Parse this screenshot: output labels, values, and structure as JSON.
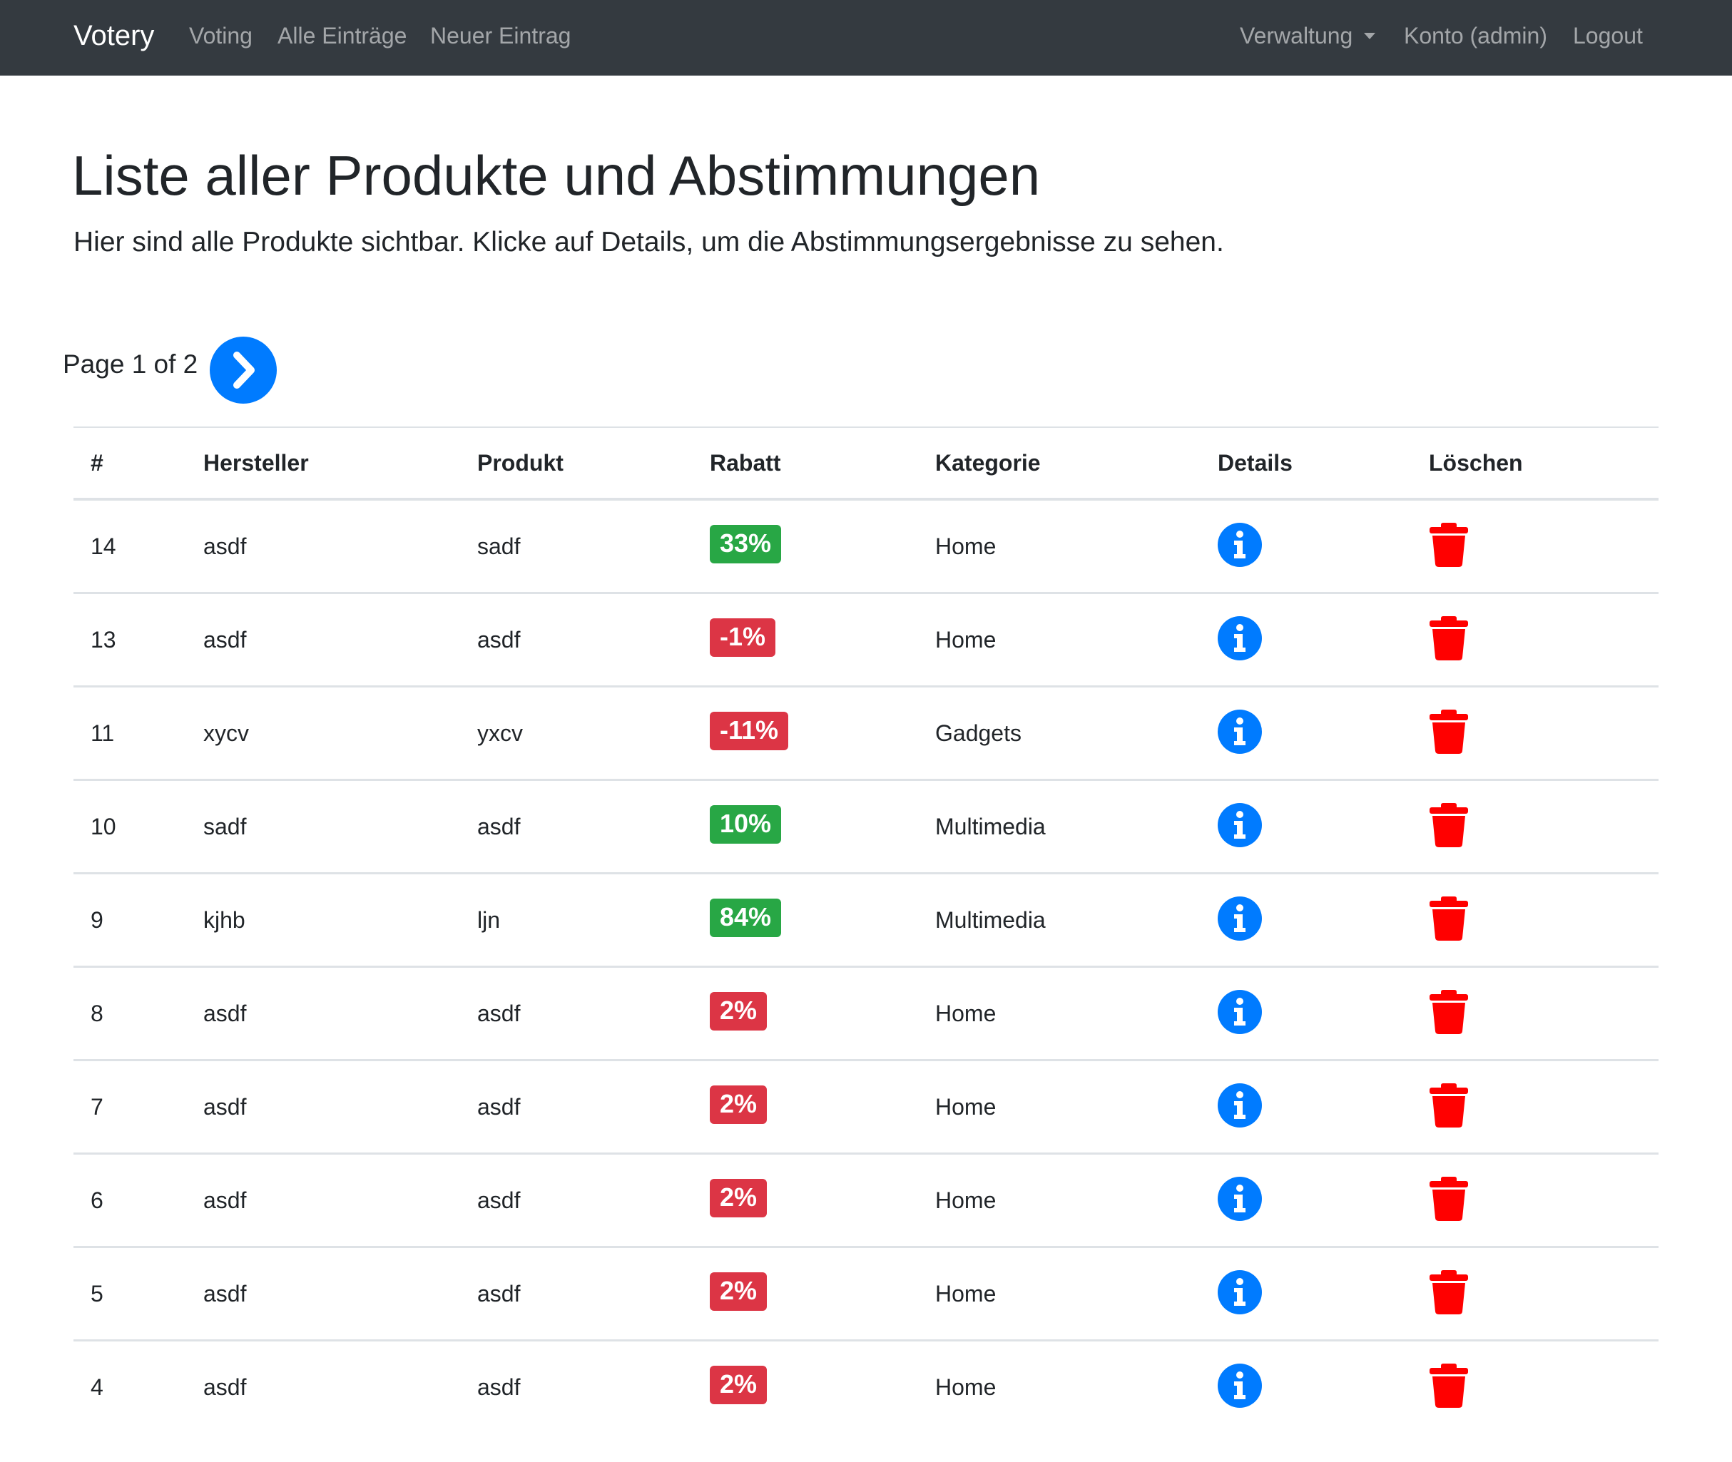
{
  "navbar": {
    "brand": "Votery",
    "links": [
      "Voting",
      "Alle Einträge",
      "Neuer Eintrag"
    ],
    "right_links": {
      "admin": "Verwaltung",
      "account": "Konto (admin)",
      "logout": "Logout"
    }
  },
  "header": {
    "title": "Liste aller Produkte und Abstimmungen",
    "lead": "Hier sind alle Produkte sichtbar. Klicke auf Details, um die Abstimmungsergebnisse zu sehen."
  },
  "pagination": {
    "text": "Page 1 of 2",
    "next_icon": "chevron-right-icon"
  },
  "table": {
    "columns": [
      "#",
      "Hersteller",
      "Produkt",
      "Rabatt",
      "Kategorie",
      "Details",
      "Löschen"
    ],
    "rows": [
      {
        "id": "14",
        "manufacturer": "asdf",
        "product": "sadf",
        "discount": "33%",
        "discount_status": "success",
        "category": "Home"
      },
      {
        "id": "13",
        "manufacturer": "asdf",
        "product": "asdf",
        "discount": "-1%",
        "discount_status": "danger",
        "category": "Home"
      },
      {
        "id": "11",
        "manufacturer": "xycv",
        "product": "yxcv",
        "discount": "-11%",
        "discount_status": "danger",
        "category": "Gadgets"
      },
      {
        "id": "10",
        "manufacturer": "sadf",
        "product": "asdf",
        "discount": "10%",
        "discount_status": "success",
        "category": "Multimedia"
      },
      {
        "id": "9",
        "manufacturer": "kjhb",
        "product": "ljn",
        "discount": "84%",
        "discount_status": "success",
        "category": "Multimedia"
      },
      {
        "id": "8",
        "manufacturer": "asdf",
        "product": "asdf",
        "discount": "2%",
        "discount_status": "danger",
        "category": "Home"
      },
      {
        "id": "7",
        "manufacturer": "asdf",
        "product": "asdf",
        "discount": "2%",
        "discount_status": "danger",
        "category": "Home"
      },
      {
        "id": "6",
        "manufacturer": "asdf",
        "product": "asdf",
        "discount": "2%",
        "discount_status": "danger",
        "category": "Home"
      },
      {
        "id": "5",
        "manufacturer": "asdf",
        "product": "asdf",
        "discount": "2%",
        "discount_status": "danger",
        "category": "Home"
      },
      {
        "id": "4",
        "manufacturer": "asdf",
        "product": "asdf",
        "discount": "2%",
        "discount_status": "danger",
        "category": "Home"
      }
    ],
    "details_icon": "info-circle-icon",
    "delete_icon": "trash-icon"
  },
  "colors": {
    "navbar_bg": "#343a40",
    "primary": "#007bff",
    "success": "#28a745",
    "danger": "#dc3545",
    "delete_red": "#ff0000"
  }
}
